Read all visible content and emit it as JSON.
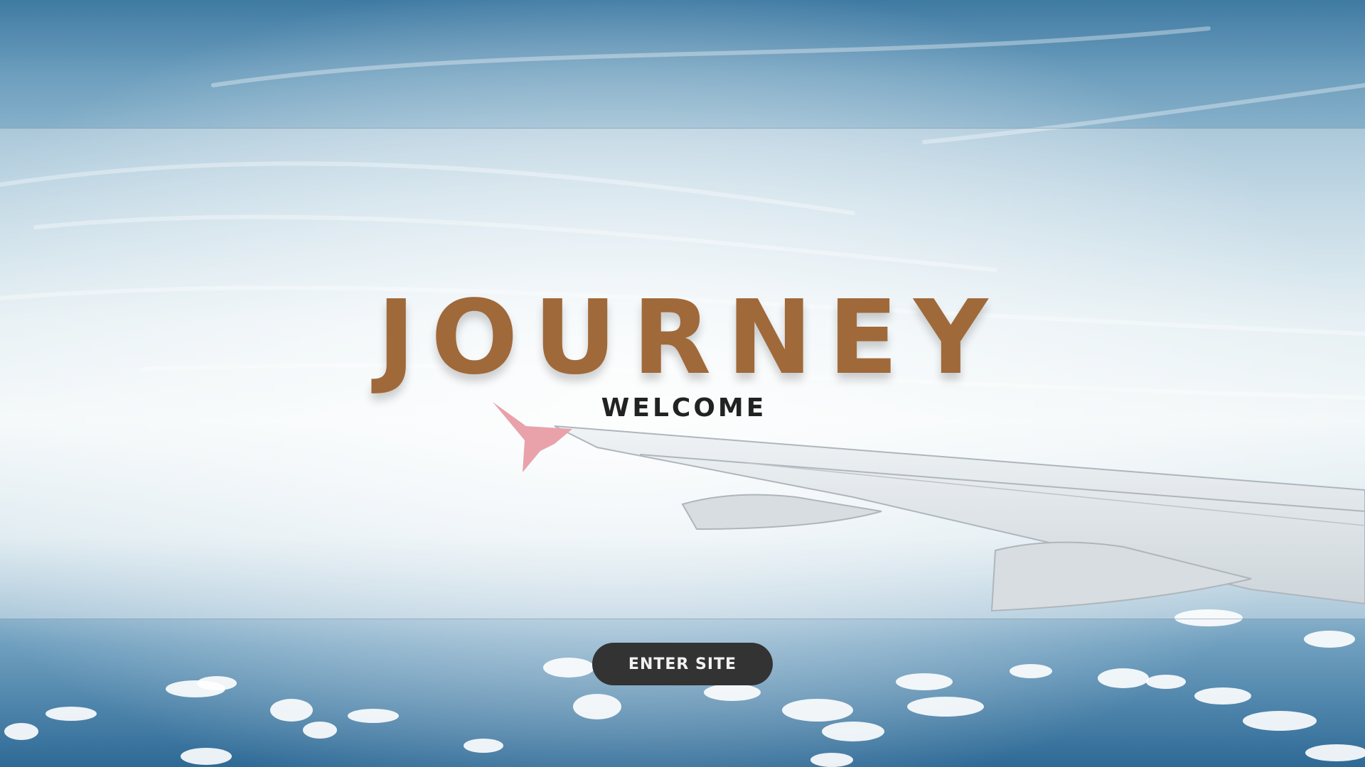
{
  "hero": {
    "title": "JOURNEY",
    "subtitle": "WELCOME"
  },
  "cta": {
    "label": "ENTER SITE"
  },
  "colors": {
    "title": "#a0693a",
    "subtitle": "#222222",
    "button_bg": "#333333",
    "button_text": "#f2f2f2",
    "winglet": "#e07a86",
    "wing": "#d6dde2"
  },
  "background": {
    "description_icon": "airplane-wing-over-clouds"
  }
}
